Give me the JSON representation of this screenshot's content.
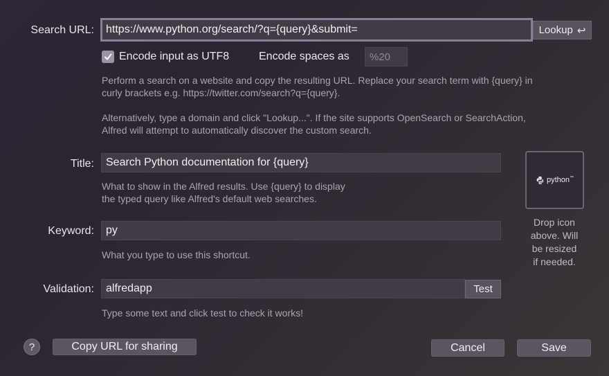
{
  "search_url": {
    "label": "Search URL:",
    "value": "https://www.python.org/search/?q={query}&submit=",
    "lookup_label": "Lookup",
    "lookup_icon": "return-arrow-icon"
  },
  "options": {
    "encode_utf8_label": "Encode input as UTF8",
    "encode_utf8_checked": true,
    "encode_spaces_label": "Encode spaces as",
    "encode_spaces_placeholder": "%20"
  },
  "help_text": {
    "line1": "Perform a search on a website and copy the resulting URL. Replace your search term with {query} in",
    "line2": "curly brackets e.g. https://twitter.com/search?q={query}.",
    "line3": "Alternatively, type a domain and click \"Lookup...\". If the site supports OpenSearch or SearchAction,",
    "line4": "Alfred will attempt to automatically discover the custom search."
  },
  "title": {
    "label": "Title:",
    "value": "Search Python documentation for {query}",
    "hint_line1": "What to show in the Alfred results. Use {query} to display",
    "hint_line2": "the typed query like Alfred's default web searches."
  },
  "keyword": {
    "label": "Keyword:",
    "value": "py",
    "hint": "What you type to use this shortcut."
  },
  "validation": {
    "label": "Validation:",
    "value": "alfredapp",
    "test_label": "Test",
    "hint": "Type some text and click test to check it works!"
  },
  "icon_well": {
    "logo_text": "python",
    "logo_tm": "™",
    "caption_line1": "Drop icon",
    "caption_line2": "above. Will",
    "caption_line3": "be resized",
    "caption_line4": "if needed."
  },
  "footer": {
    "help_label": "?",
    "copy_label": "Copy URL for sharing",
    "cancel_label": "Cancel",
    "save_label": "Save"
  }
}
